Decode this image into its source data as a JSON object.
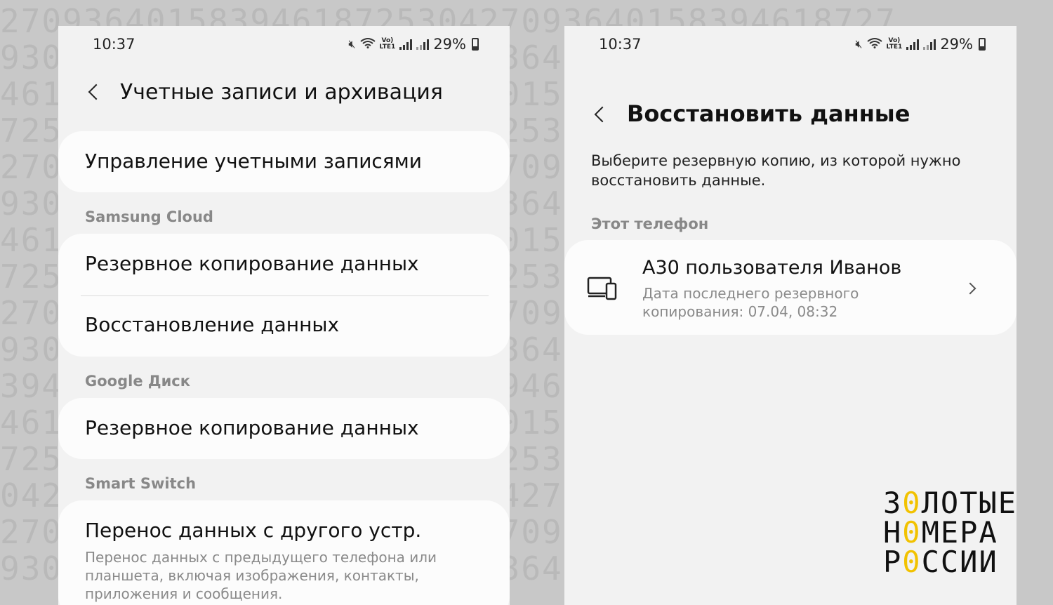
{
  "background_digits": [
    "2709364015839461872530427093640158394618727",
    "9304615839461872530427093640158394618725304",
    "4615839461872530427093640158394618725304270",
    "7253042709364015839461872530427093640158394",
    "2709364015839461872530427093640158394618725",
    "9304615839461872530427093640158394618725304",
    "4615839461872530427093640158394618725304270",
    "7253042709364015839461872530427093640158394",
    "2709364015839461872530427093640158394618725",
    "9304615839461872530427093640158394618725304",
    "3946187253042709364015839461872530427093640",
    "4615839461872530427093640158394618725304270",
    "7253042709364015839461872530427093640158394",
    "0427093640158394618725304270936401583946187",
    "2709364015839461872530427093640158394618725",
    "9304615839461872530427093640158394618725304"
  ],
  "left": {
    "status": {
      "time": "10:37",
      "battery": "29%",
      "volte": "Vo)",
      "lte": "LTE1"
    },
    "header": {
      "title": "Учетные записи и архивация"
    },
    "items": {
      "manage_accounts": "Управление учетными записями",
      "samsung_cloud_label": "Samsung Cloud",
      "samsung_backup": "Резервное копирование данных",
      "samsung_restore": "Восстановление данных",
      "google_drive_label": "Google Диск",
      "google_backup": "Резервное копирование данных",
      "smart_switch_label": "Smart Switch",
      "transfer_title": "Перенос данных с другого устр.",
      "transfer_sub": "Перенос данных с предыдущего телефона или планшета, включая изображения, контакты, приложения и сообщения."
    }
  },
  "right": {
    "status": {
      "time": "10:37",
      "battery": "29%",
      "volte": "Vo)",
      "lte": "LTE1"
    },
    "header": {
      "title": "Восстановить данные"
    },
    "subtitle": "Выберите резервную копию, из которой нужно восстановить данные.",
    "section_label": "Этот телефон",
    "backup_item": {
      "title": "A30 пользователя Иванов",
      "sub": "Дата последнего резервного копирования: 07.04, 08:32"
    }
  },
  "logo": {
    "line1_a": "З",
    "line1_b": "0",
    "line1_c": "ЛОТЫЕ",
    "line2_a": "Н",
    "line2_b": "0",
    "line2_c": "МЕРА",
    "line3_a": "Р",
    "line3_b": "0",
    "line3_c": "ССИИ"
  },
  "colors": {
    "accent_gold": "#f2c200",
    "background": "#c8c8c8",
    "panel": "#f2f2f2",
    "card": "#fcfcfc"
  }
}
